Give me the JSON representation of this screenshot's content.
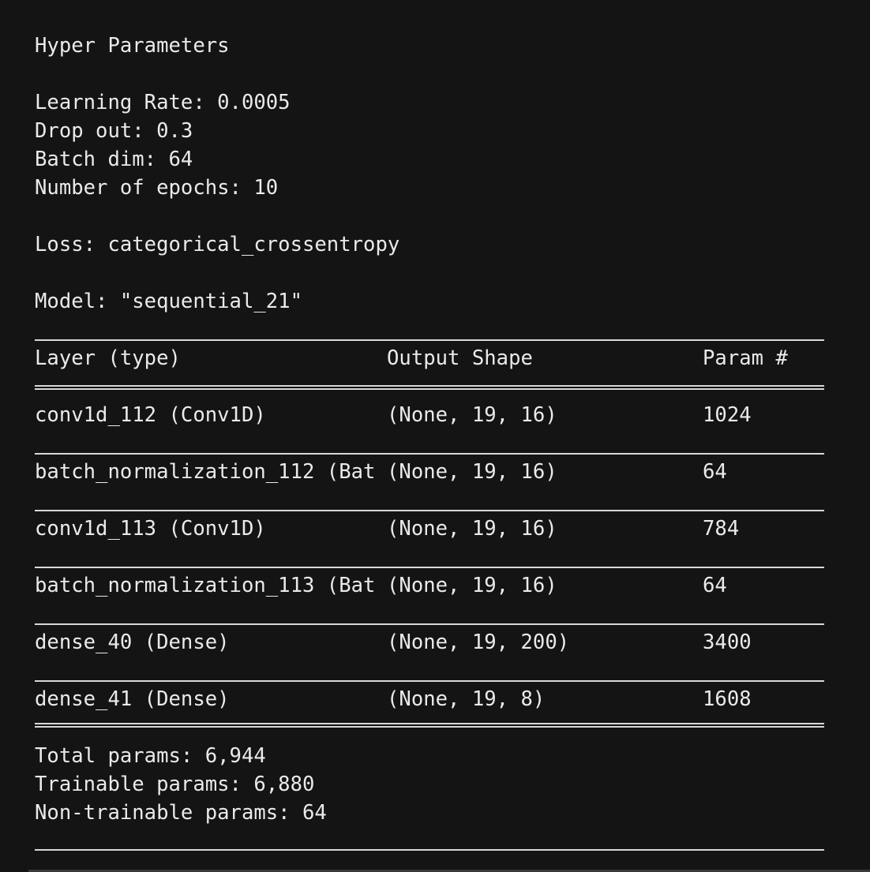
{
  "output": {
    "heading": "Hyper Parameters",
    "learning_rate": "Learning Rate: 0.0005",
    "dropout": "Drop out: 0.3",
    "batch_dim": "Batch dim: 64",
    "epochs": "Number of epochs: 10",
    "loss": "Loss: categorical_crossentropy",
    "model_name": "Model: \"sequential_21\""
  },
  "summary_table": {
    "headers": [
      "Layer (type)",
      "Output Shape",
      "Param #"
    ],
    "rows": [
      {
        "layer": "conv1d_112 (Conv1D)",
        "shape": "(None, 19, 16)",
        "params": "1024"
      },
      {
        "layer": "batch_normalization_112 (Bat",
        "shape": "(None, 19, 16)",
        "params": "64"
      },
      {
        "layer": "conv1d_113 (Conv1D)",
        "shape": "(None, 19, 16)",
        "params": "784"
      },
      {
        "layer": "batch_normalization_113 (Bat",
        "shape": "(None, 19, 16)",
        "params": "64"
      },
      {
        "layer": "dense_40 (Dense)",
        "shape": "(None, 19, 200)",
        "params": "3400"
      },
      {
        "layer": "dense_41 (Dense)",
        "shape": "(None, 19, 8)",
        "params": "1608"
      }
    ]
  },
  "totals": {
    "total": "Total params: 6,944",
    "trainable": "Trainable params: 6,880",
    "non_trainable": "Non-trainable params: 64"
  }
}
